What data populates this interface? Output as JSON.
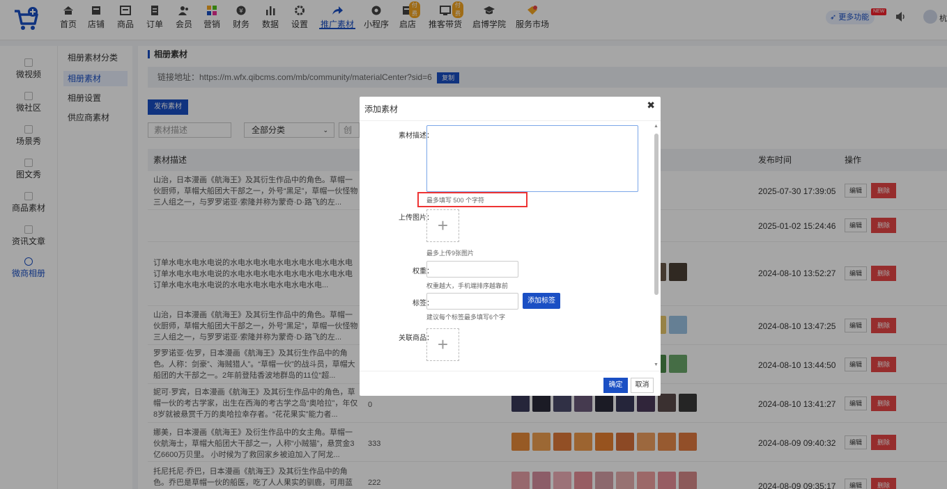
{
  "topnav": {
    "items": [
      {
        "label": "首页",
        "icon": "home-icon"
      },
      {
        "label": "店铺",
        "icon": "store-icon"
      },
      {
        "label": "商品",
        "icon": "goods-icon"
      },
      {
        "label": "订单",
        "icon": "order-icon"
      },
      {
        "label": "会员",
        "icon": "member-icon"
      },
      {
        "label": "营销",
        "icon": "marketing-icon"
      },
      {
        "label": "财务",
        "icon": "finance-icon"
      },
      {
        "label": "数据",
        "icon": "data-icon"
      },
      {
        "label": "设置",
        "icon": "settings-icon"
      },
      {
        "label": "推广素材",
        "icon": "share-icon"
      },
      {
        "label": "小程序",
        "icon": "miniapp-icon"
      },
      {
        "label": "启店",
        "icon": "open-store-icon"
      },
      {
        "label": "推客带货",
        "icon": "promoter-icon"
      },
      {
        "label": "启博学院",
        "icon": "academy-icon"
      },
      {
        "label": "服务市场",
        "icon": "market-icon"
      }
    ],
    "paid_badge": "付费",
    "more_label": "更多功能",
    "new_badge": "NEW",
    "user_initial": "杭"
  },
  "sidenav": {
    "items": [
      {
        "label": "微视频",
        "icon": "video-icon"
      },
      {
        "label": "微社区",
        "icon": "community-icon"
      },
      {
        "label": "场景秀",
        "icon": "scene-icon"
      },
      {
        "label": "图文秀",
        "icon": "article-icon"
      },
      {
        "label": "商品素材",
        "icon": "goods-material-icon"
      },
      {
        "label": "资讯文章",
        "icon": "news-icon"
      },
      {
        "label": "微商相册",
        "icon": "album-icon"
      }
    ]
  },
  "subnav": {
    "items": [
      "相册素材分类",
      "相册素材",
      "相册设置",
      "供应商素材"
    ]
  },
  "main": {
    "title": "相册素材",
    "link_label": "链接地址：https://m.wfx.qibcms.com/mb/community/materialCenter?sid=6",
    "copy_label": "复制",
    "publish_label": "发布素材",
    "search_placeholder": "素材描述",
    "category_value": "全部分类",
    "create_placeholder": "创建",
    "headers": {
      "desc": "素材描述",
      "time": "发布时间",
      "actions": "操作"
    },
    "edit_label": "编辑",
    "delete_label": "删除",
    "rows": [
      {
        "desc": "山治，日本漫画《航海王》及其衍生作品中的角色。草帽一伙厨师，草帽大船团大干部之一，外号“黑足”，草帽一伙怪物三人组之一，与罗罗诺亚·索隆并称为蒙奇·D·路飞的左...",
        "weight": "",
        "time": "2025-07-30 17:39:05"
      },
      {
        "desc": "",
        "weight": "",
        "time": "2025-01-02 15:24:46"
      },
      {
        "desc": "订单水电水电水电说的水电水电水电水电水电水电水电水电订单水电水电水电说的水电水电水电水电水电水电水电水电订单水电水电水电说的水电水电水电水电水电水电...",
        "weight": "",
        "time": "2024-08-10 13:52:27"
      },
      {
        "desc": "山治，日本漫画《航海王》及其衍生作品中的角色。草帽一伙厨师，草帽大船团大干部之一，外号“黑足”，草帽一伙怪物三人组之一，与罗罗诺亚·索隆并称为蒙奇·D·路飞的左...",
        "weight": "",
        "time": "2024-08-10 13:47:25"
      },
      {
        "desc": "罗罗诺亚·佐罗，日本漫画《航海王》及其衍生作品中的角色。人称：剑豪”、海贼猎人”。“草帽一伙”的战斗员，草帽大船团的大干部之一。2年前登陆香波地群岛的11位“超...",
        "weight": "",
        "time": "2024-08-10 13:44:50"
      },
      {
        "desc": "妮可·罗宾，日本漫画《航海王》及其衍生作品中的角色，草帽一伙的考古学家，出生在西海的考古学之岛“奥哈拉”，年仅8岁就被悬赏千万的奥哈拉幸存者。“花花果实”能力者...",
        "weight": "0",
        "time": "2024-08-10 13:41:27"
      },
      {
        "desc": "娜美，日本漫画《航海王》及衍生作品中的女主角。草帽一伙航海士，草帽大船团大干部之一，人称“小贼猫”，悬赏金3亿6600万贝里。 小时候为了救回家乡被迫加入了阿龙...",
        "weight": "333",
        "time": "2024-08-09 09:40:32"
      },
      {
        "desc": "托尼托尼·乔巴，日本漫画《航海王》及其衍生作品中的角色。乔巴是草帽一伙的船医，吃了人人果实的驯鹿，可用蓝波球进行八段",
        "weight": "222",
        "time": "2024-08-09 09:35:17"
      }
    ]
  },
  "modal": {
    "title": "添加素材",
    "desc_label": "素材描述：",
    "desc_hint": "最多填写 500 个字符",
    "upload_label": "上传图片：",
    "upload_hint": "最多上传9张图片",
    "weight_label": "权重：",
    "weight_hint": "权重越大，手机端排序越靠前",
    "tag_label": "标签：",
    "add_tag_label": "添加标签",
    "tag_hint": "建议每个标签最多填写6个字",
    "related_label": "关联商品：",
    "ok_label": "确定",
    "cancel_label": "取消"
  },
  "colors": {
    "accent": "#1a4fc4",
    "danger": "#e64545"
  }
}
